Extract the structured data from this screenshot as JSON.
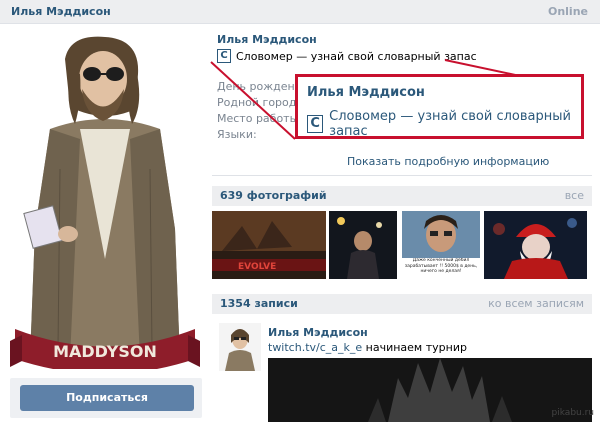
{
  "header": {
    "name": "Илья Мэддисон",
    "online": "Online"
  },
  "avatar": {
    "banner_text": "MADDYSON"
  },
  "actions": {
    "subscribe_label": "Подписаться"
  },
  "profile": {
    "name": "Илья Мэддисон",
    "app_icon_letter": "C",
    "status_text": "Словомер — узнай свой словарный запас",
    "info_labels": [
      "День рождения:",
      "Родной город:",
      "Место работы:",
      "Языки:"
    ],
    "show_more": "Показать подробную информацию"
  },
  "callout": {
    "name": "Илья Мэддисон",
    "app_icon_letter": "C",
    "status_text": "Словомер — узнай свой словарный запас"
  },
  "photos": {
    "title": "639 фотографий",
    "all_label": "все",
    "items": [
      {
        "caption": "EVOLVE"
      },
      {
        "caption": ""
      },
      {
        "caption": "Даже конченный дебил зарабатывает !! 5000$ в день, ничего не делая!"
      },
      {
        "caption": ""
      }
    ]
  },
  "wall": {
    "title": "1354 записи",
    "all_label": "ко всем записям",
    "post": {
      "author": "Илья Мэддисон",
      "link": "twitch.tv/c_a_k_e",
      "text": " начинаем турнир"
    }
  },
  "watermark": "pikabu.ru",
  "colors": {
    "accent": "#2b587a",
    "highlight": "#c8102e",
    "button": "#5e81a8"
  }
}
